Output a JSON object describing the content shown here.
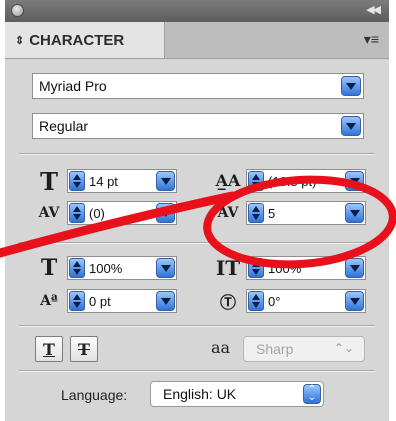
{
  "panel": {
    "tab_label": "CHARACTER",
    "tab_icon": "double-arrow-icon",
    "menu_icon": "panel-menu-icon"
  },
  "font": {
    "family": "Myriad Pro",
    "style": "Regular"
  },
  "controls": {
    "font_size": "14 pt",
    "leading": "(16.8 pt)",
    "kerning": "(0)",
    "tracking": "5",
    "vertical_scale": "100%",
    "horizontal_scale": "100%",
    "baseline_shift": "0 pt",
    "rotation": "0°"
  },
  "bottom": {
    "antialias_icon_label": "aa",
    "antialias_value": "Sharp",
    "language_label": "Language:",
    "language_value": "English: UK"
  },
  "colors": {
    "accent_blue": "#2f74d8",
    "annotation_red": "#e8101a",
    "panel_bg": "#d6d6d6"
  }
}
